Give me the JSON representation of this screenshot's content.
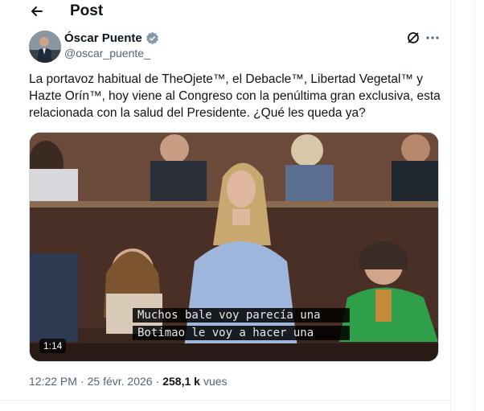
{
  "header": {
    "title": "Post"
  },
  "author": {
    "name": "Óscar Puente",
    "handle": "@oscar_puente_"
  },
  "tweet": {
    "text": "La portavoz habitual de TheOjete™, el Debacle™, Libertad Vegetal™ y Hazte Orín™, hoy viene al Congreso con la penúltima gran exclusiva, esta relacionada con la salud del Presidente. ¿Qué les queda ya?"
  },
  "media": {
    "subtitle_line1": "Muchos bale voy parecía una",
    "subtitle_line2": "Botimao le voy a hacer una",
    "duration": "1:14"
  },
  "meta": {
    "time": "12:22 PM",
    "separator": "·",
    "date": "25 févr. 2026",
    "views_count": "258,1 k",
    "views_label": "vues"
  },
  "icons": {
    "back": "arrow-left-icon",
    "verified": "verified-badge-icon",
    "grok": "grok-icon",
    "more": "more-dots-icon"
  },
  "colors": {
    "verified": "#829aab",
    "text": "#0f1419",
    "muted": "#536471"
  }
}
